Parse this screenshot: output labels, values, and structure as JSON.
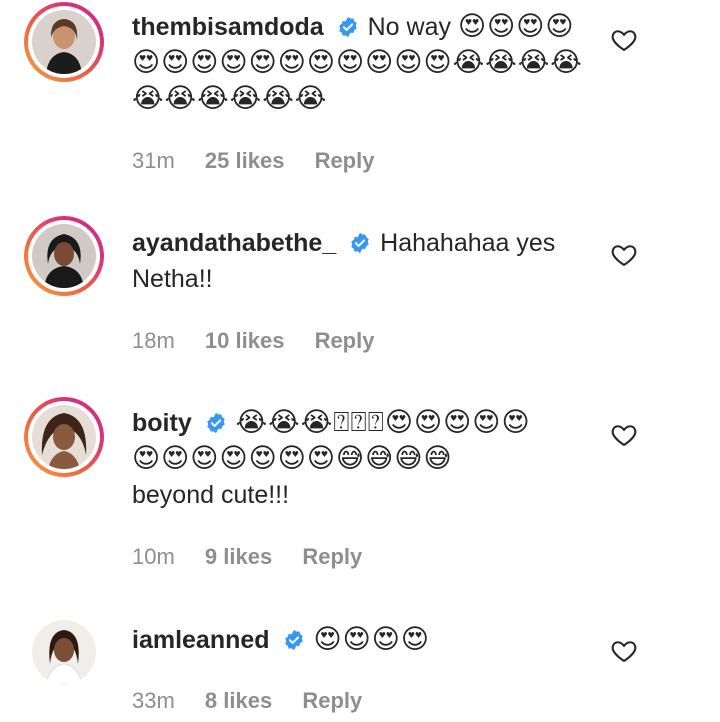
{
  "comments": [
    {
      "username": "thembisamdoda",
      "text": "No way",
      "emojis": "😍😍😍😍😍😍😍😍😍😍😍😍😍😍😍😭😭😭😭😭😭😭😭😭😭",
      "time": "31m",
      "likes": "25 likes",
      "reply": "Reply"
    },
    {
      "username": "ayandathabethe_",
      "text": "Hahahahaa yes Netha!!",
      "time": "18m",
      "likes": "10 likes",
      "reply": "Reply"
    },
    {
      "username": "boity",
      "emojis_line1": "😭😭😭⍰⍰⍰😍😍😍😍😍",
      "emojis_line2": "😍😍😍😍😍😍😍😅😅😅😅",
      "text": "beyond cute!!!",
      "time": "10m",
      "likes": "9 likes",
      "reply": "Reply"
    },
    {
      "username": "iamleanned",
      "emojis": "😍😍😍😍",
      "time": "33m",
      "likes": "8 likes",
      "reply": "Reply"
    }
  ],
  "colors": {
    "username": "#262626",
    "meta": "#8e8e8e",
    "verified": "#3897f0"
  },
  "icons": {
    "verified": "verified-badge-icon",
    "like": "heart-outline-icon"
  }
}
